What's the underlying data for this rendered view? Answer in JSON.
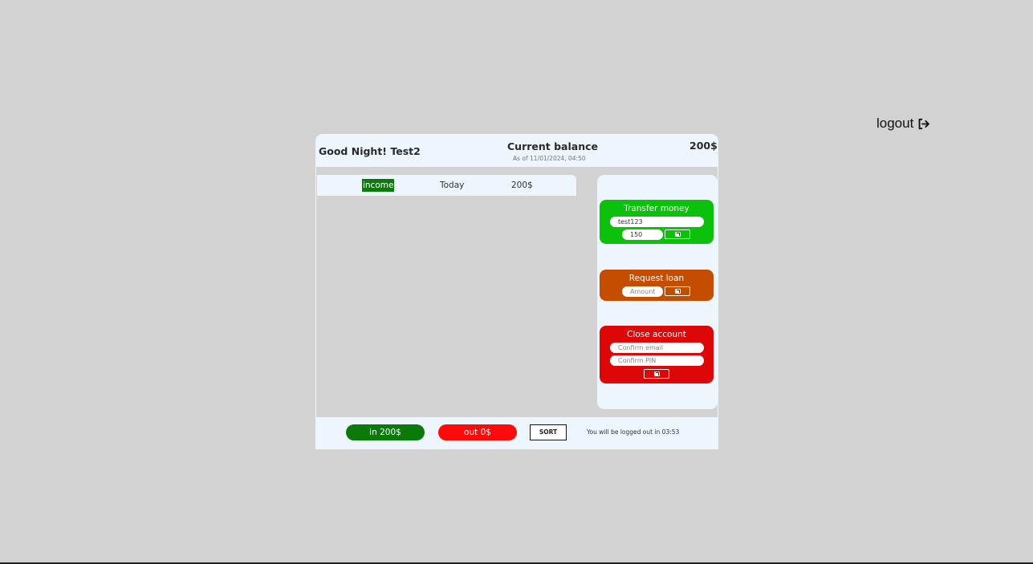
{
  "logout": {
    "label": "logout",
    "icon": "logout-arrow-icon"
  },
  "header": {
    "greeting": "Good Night! Test2",
    "balance_label": "Current balance",
    "balance_date": "As of 11/01/2024, 04:50",
    "balance_value": "200$"
  },
  "movements": [
    {
      "type": "income",
      "date": "Today",
      "value": "200$"
    }
  ],
  "operations": {
    "transfer": {
      "title": "Transfer money",
      "to_value": "test123",
      "amount_value": "150",
      "submit_icon": "arrow-submit-icon"
    },
    "loan": {
      "title": "Request loan",
      "amount_placeholder": "Amount",
      "submit_icon": "arrow-submit-icon"
    },
    "close": {
      "title": "Close account",
      "email_placeholder": "Confirm email",
      "pin_placeholder": "Confirm PIN",
      "submit_icon": "arrow-submit-icon"
    }
  },
  "summary": {
    "in_label": "in 200$",
    "out_label": "out 0$",
    "sort_label": "SORT",
    "timer_text": "You will be logged out in 03:53"
  },
  "colors": {
    "income": "#0a7a0a",
    "transfer": "#0cc10c",
    "loan": "#c44d00",
    "close": "#dd0707",
    "out": "#ff0a0a",
    "panel": "#eef6fd",
    "background": "#d2d2d2"
  }
}
